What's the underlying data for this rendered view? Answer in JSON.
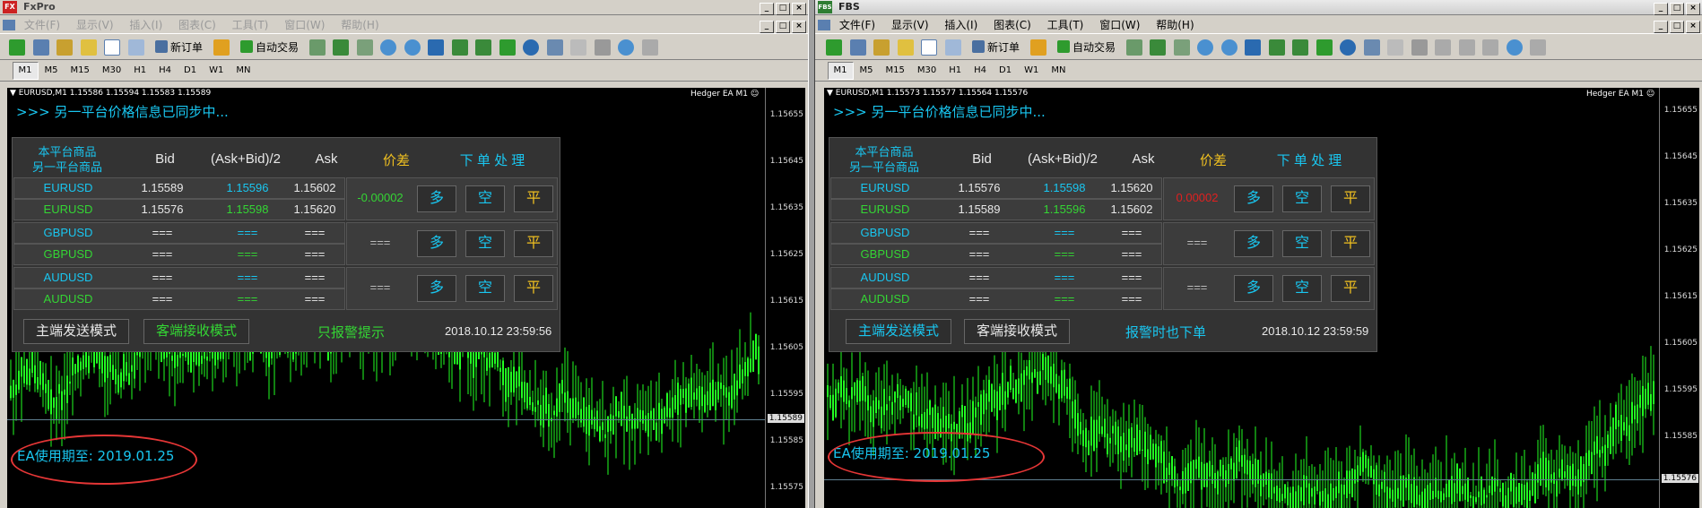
{
  "windows": [
    {
      "title": "FxPro",
      "active": false,
      "icon_label": "FX",
      "icon_color": "#cc2222",
      "menus": [
        "文件(F)",
        "显示(V)",
        "插入(I)",
        "图表(C)",
        "工具(T)",
        "窗口(W)",
        "帮助(H)"
      ],
      "toolbar": {
        "new_order": "新订单",
        "auto_trade": "自动交易"
      },
      "timeframes": [
        "M1",
        "M5",
        "M15",
        "M30",
        "H1",
        "H4",
        "D1",
        "W1",
        "MN"
      ],
      "selected_timeframe": "M1",
      "chart": {
        "symbol_info": "▼ EURUSD,M1  1.15586 1.15594 1.15583 1.15589",
        "ea_name": "Hedger EA M1 ☺",
        "sync_text": ">>> 另一平台价格信息已同步中...",
        "price_ticks": [
          "1.15655",
          "1.15645",
          "1.15635",
          "1.15625",
          "1.15615",
          "1.15605",
          "1.15595",
          "1.15585",
          "1.15575"
        ],
        "current_price": "1.15589",
        "ea_expiry": "EA使用期至: 2019.01.25"
      },
      "panel": {
        "header_sym1": "本平台商品",
        "header_sym2": "另一平台商品",
        "header_bid": "Bid",
        "header_mid": "(Ask+Bid)/2",
        "header_ask": "Ask",
        "header_spread": "价差",
        "header_action": "下 单 处 理",
        "rows": [
          {
            "symbol": "EURUSD",
            "bid": "1.15589",
            "mid": "1.15596",
            "ask": "1.15602",
            "sym_color": "blue"
          },
          {
            "symbol": "EURUSD",
            "bid": "1.15576",
            "mid": "1.15598",
            "ask": "1.15620",
            "sym_color": "green"
          },
          {
            "symbol": "GBPUSD",
            "bid": "===",
            "mid": "===",
            "ask": "===",
            "sym_color": "blue"
          },
          {
            "symbol": "GBPUSD",
            "bid": "===",
            "mid": "===",
            "ask": "===",
            "sym_color": "green"
          },
          {
            "symbol": "AUDUSD",
            "bid": "===",
            "mid": "===",
            "ask": "===",
            "sym_color": "blue"
          },
          {
            "symbol": "AUDUSD",
            "bid": "===",
            "mid": "===",
            "ask": "===",
            "sym_color": "green"
          }
        ],
        "spreads": [
          {
            "value": "-0.00002",
            "color": "green"
          },
          {
            "value": "===",
            "color": "gray"
          },
          {
            "value": "===",
            "color": "gray"
          }
        ],
        "btn_long": "多",
        "btn_short": "空",
        "btn_flat": "平",
        "mode_send": "主端发送模式",
        "mode_recv": "客端接收模式",
        "send_active": false,
        "recv_active": true,
        "status_text": "只报警提示",
        "timestamp": "2018.10.12 23:59:56"
      }
    },
    {
      "title": "FBS",
      "active": true,
      "icon_label": "FBS",
      "icon_color": "#2e7d32",
      "menus": [
        "文件(F)",
        "显示(V)",
        "插入(I)",
        "图表(C)",
        "工具(T)",
        "窗口(W)",
        "帮助(H)"
      ],
      "toolbar": {
        "new_order": "新订单",
        "auto_trade": "自动交易"
      },
      "timeframes": [
        "M1",
        "M5",
        "M15",
        "M30",
        "H1",
        "H4",
        "D1",
        "W1",
        "MN"
      ],
      "selected_timeframe": "M1",
      "chart": {
        "symbol_info": "▼ EURUSD,M1  1.15573 1.15577 1.15564 1.15576",
        "ea_name": "Hedger EA M1 ☺",
        "sync_text": ">>> 另一平台价格信息已同步中...",
        "price_ticks": [
          "1.15655",
          "1.15645",
          "1.15635",
          "1.15625",
          "1.15615",
          "1.15605",
          "1.15595",
          "1.15585",
          "1.15576"
        ],
        "current_price": "1.15576",
        "ea_expiry": "EA使用期至: 2019.01.25"
      },
      "panel": {
        "header_sym1": "本平台商品",
        "header_sym2": "另一平台商品",
        "header_bid": "Bid",
        "header_mid": "(Ask+Bid)/2",
        "header_ask": "Ask",
        "header_spread": "价差",
        "header_action": "下 单 处 理",
        "rows": [
          {
            "symbol": "EURUSD",
            "bid": "1.15576",
            "mid": "1.15598",
            "ask": "1.15620",
            "sym_color": "blue"
          },
          {
            "symbol": "EURUSD",
            "bid": "1.15589",
            "mid": "1.15596",
            "ask": "1.15602",
            "sym_color": "green"
          },
          {
            "symbol": "GBPUSD",
            "bid": "===",
            "mid": "===",
            "ask": "===",
            "sym_color": "blue"
          },
          {
            "symbol": "GBPUSD",
            "bid": "===",
            "mid": "===",
            "ask": "===",
            "sym_color": "green"
          },
          {
            "symbol": "AUDUSD",
            "bid": "===",
            "mid": "===",
            "ask": "===",
            "sym_color": "blue"
          },
          {
            "symbol": "AUDUSD",
            "bid": "===",
            "mid": "===",
            "ask": "===",
            "sym_color": "green"
          }
        ],
        "spreads": [
          {
            "value": "0.00002",
            "color": "red"
          },
          {
            "value": "===",
            "color": "gray"
          },
          {
            "value": "===",
            "color": "gray"
          }
        ],
        "btn_long": "多",
        "btn_short": "空",
        "btn_flat": "平",
        "mode_send": "主端发送模式",
        "mode_recv": "客端接收模式",
        "send_active": true,
        "recv_active": false,
        "status_text": "报警时也下单",
        "timestamp": "2018.10.12 23:59:59"
      }
    }
  ],
  "colors": {
    "cyan": "#19c6f0",
    "green": "#34d534",
    "gold": "#f0c020",
    "red": "#e02020",
    "candle": "#22ff22",
    "annotation_ring": "#e53636"
  }
}
